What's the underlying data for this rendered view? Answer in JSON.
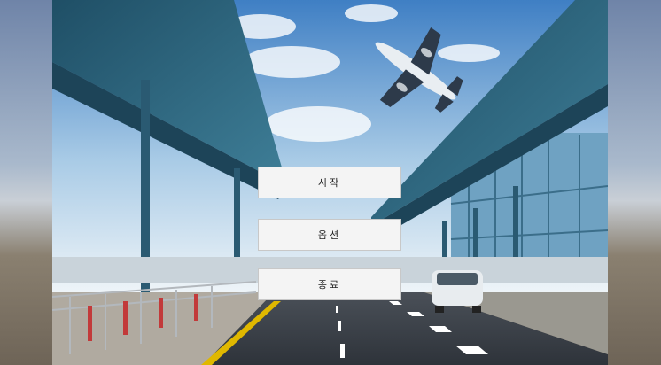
{
  "menu": {
    "start_label": "시작",
    "options_label": "옵션",
    "quit_label": "종료"
  },
  "colors": {
    "sky_top": "#3f7fc4",
    "sky_bottom": "#e8f0f6",
    "canopy": "#2f6a86",
    "road": "#3a4048",
    "button_bg": "#f4f4f4"
  }
}
